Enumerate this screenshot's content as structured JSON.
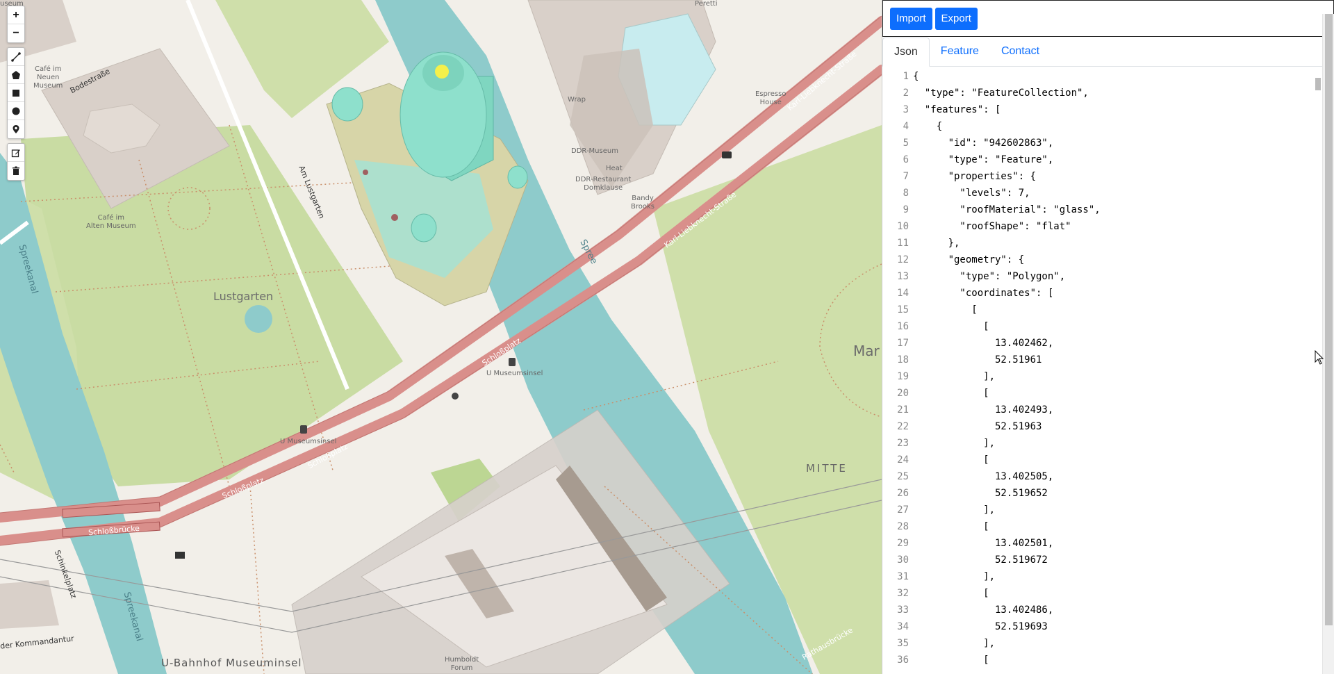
{
  "map": {
    "labels": {
      "lustgarten": "Lustgarten",
      "mitte": "MITTE",
      "mar": "Mar",
      "spreekanal_left": "Spreekanal",
      "spreekanal_bottom": "Spreekanal",
      "spree": "Spree",
      "am_lustgarten": "Am Lustgarten",
      "bodestrasse": "Bodestraße",
      "karl_liebknecht_1": "Karl-Liebknecht-Straße",
      "karl_liebknecht_2": "Karl-Liebknecht-Straße",
      "schlossplatz_1": "Schloßplatz",
      "schlossplatz_2": "Schloßplatz",
      "schlossplatz_3": "Schloßplatz",
      "schlossbruecke": "Schloßbrücke",
      "schinkelplatz": "Schinkelplatz",
      "rathausbruecke": "Rathausbrücke",
      "kommandantur": "der Kommandantur",
      "u_museumsinsel_1": "U Museumsinsel",
      "u_museumsinsel_2": "U Museumsinsel",
      "u_bahnhof": "U-Bahnhof Museuminsel",
      "cafe_neuen": "Café im\nNeuen\nMuseum",
      "cafe_alten": "Café im\nAlten Museum",
      "ddr_museum": "DDR-Museum",
      "ddr_restaurant": "DDR-Restaurant\nDomklause",
      "heat": "Heat",
      "bandy": "Bandy\nBrooks",
      "wrap": "Wrap",
      "espresso": "Espresso\nHouse",
      "humboldt": "Humboldt\nForum",
      "useum": "useum",
      "peretti": "Peretti"
    }
  },
  "toolbar": {
    "zoom_in": "+",
    "zoom_out": "−"
  },
  "panel": {
    "import_label": "Import",
    "export_label": "Export",
    "tabs": [
      "Json",
      "Feature",
      "Contact"
    ],
    "active_tab": "Json"
  },
  "editor": {
    "lines": [
      "{",
      "  \"type\": \"FeatureCollection\",",
      "  \"features\": [",
      "    {",
      "      \"id\": \"942602863\",",
      "      \"type\": \"Feature\",",
      "      \"properties\": {",
      "        \"levels\": 7,",
      "        \"roofMaterial\": \"glass\",",
      "        \"roofShape\": \"flat\"",
      "      },",
      "      \"geometry\": {",
      "        \"type\": \"Polygon\",",
      "        \"coordinates\": [",
      "          [",
      "            [",
      "              13.402462,",
      "              52.51961",
      "            ],",
      "            [",
      "              13.402493,",
      "              52.51963",
      "            ],",
      "            [",
      "              13.402505,",
      "              52.519652",
      "            ],",
      "            [",
      "              13.402501,",
      "              52.519672",
      "            ],",
      "            [",
      "              13.402486,",
      "              52.519693",
      "            ],",
      "            ["
    ]
  }
}
